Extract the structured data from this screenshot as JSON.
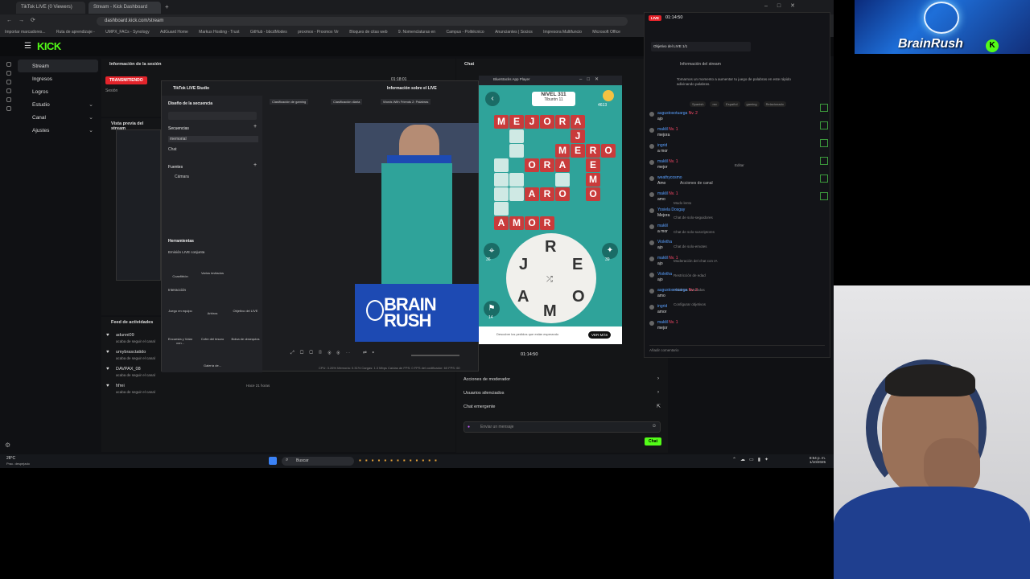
{
  "browser": {
    "tabs": [
      "TikTok LIVE (0 Viewers)",
      "Stream - Kick Dashboard"
    ],
    "url": "dashboard.kick.com/stream",
    "bookmarks": [
      "Importar marcadores...",
      "Ruta de aprendizaje -",
      "UMPX_FACs - Synology",
      "AdGuard Home",
      "Markus Hosting - Trust",
      "GitHub - bbcdModes",
      "proxmox - Proxmox Vir",
      "Bloques de citas web",
      "9. Nomenclaturas en",
      "Campus - Politécnico",
      "Anunciantes | Socios",
      "Impresora Multifuncio",
      "Microsoft Office"
    ]
  },
  "kick": {
    "logo": "KICK",
    "sidebar": [
      {
        "label": "Stream",
        "active": true
      },
      {
        "label": "Ingresos",
        "active": false
      },
      {
        "label": "Logros",
        "active": false
      },
      {
        "label": "Estudio",
        "active": false,
        "chevron": "⌄"
      },
      {
        "label": "Canal",
        "active": false,
        "chevron": "⌄"
      },
      {
        "label": "Ajustes",
        "active": false,
        "chevron": "⌄"
      }
    ],
    "session_title": "Información de la sesión",
    "live_badge": "TRANSMITIENDO",
    "session_label": "Sesión",
    "uptime": "01:18:01",
    "preview_title": "Vista previa del stream",
    "activity_title": "Feed de actividades",
    "activity": [
      {
        "user": "adunni09",
        "text": "acaba de seguir el canal"
      },
      {
        "user": "umybrasctatido",
        "text": "acaba de seguir el canal"
      },
      {
        "user": "DAVPAX_08",
        "text": "acaba de seguir el canal"
      },
      {
        "user": "hfrei",
        "text": "acaba de seguir el canal",
        "time": "Hace 21 horas"
      }
    ],
    "chat_title": "Chat",
    "mod_items": [
      "Acciones de moderador",
      "Usuarios silenciados",
      "Chat emergente"
    ],
    "chat_placeholder": "Enviar un mensaje",
    "chat_button": "Chat"
  },
  "tiktok_studio": {
    "title": "TikTok LIVE Studio",
    "live_info": "Información sobre el LIVE",
    "scene_design": "Diseño de la secuencia",
    "sequences": "Secuencias",
    "scenes": [
      "memorial",
      "Chat"
    ],
    "sources": "Fuentes",
    "source_items": [
      "Cámara"
    ],
    "tools": "Herramientas",
    "tools_sub": "Emisión LIVE conjunta",
    "tool_items": [
      "Coanfitrión",
      "Varios invitados"
    ],
    "interaction": "Interacción",
    "interaction_items": [
      "Juego en equipo",
      "Arbiros",
      "Objetivo del LIVE",
      "Encuesta y Votar con...",
      "Cofre del tesoro",
      "Bolsa de obsequios",
      "Galería de..."
    ],
    "rank_tabs": [
      "Clasificación de gaming",
      "Clasificación diaria",
      "Words With Friends 2: Palabras"
    ],
    "timer": "01:14:50",
    "stats": "CPU: 3.26%   Memoria: 0.31%   Cargas: 1.3 Mbps   Caídas de FPS: 0   FPS del codificador: 60   FPS: 60",
    "brain_rush_banner": "BRAIN RUSH"
  },
  "game": {
    "window_title": "BlueStacks App Player",
    "level": "NIVEL 311",
    "sublevel": "Tiburón 11",
    "coins": "4613",
    "wheel_letters": [
      "R",
      "J",
      "E",
      "A",
      "O",
      "M"
    ],
    "hint_count_left": "36",
    "hint_count_right": "39",
    "hint_count_bottom": "14",
    "ad_text": "Descubre los pedidos que están esperando",
    "ad_button": "VER MÁS"
  },
  "tiktok_chat": {
    "timer": "01:14:50",
    "goal_label": "Objetivo del LIVE 1/1",
    "stream_info": "Información del stream",
    "description": "Tomarnos un momento a aumentar tu juego de palabras en este rápido adivinando palabras.",
    "tags": [
      "Spanish",
      "rec",
      "Español",
      "gaming",
      "Relacionado"
    ],
    "edit": "Editar",
    "channel_actions": "Acciones de canal",
    "actions": [
      "Modo lento",
      "Chat de solo-seguidores",
      "Chat de solo-suscriptores",
      "Chat de solo-emotes",
      "Moderación del chat con IA",
      "Restricción de edad",
      "Palabras baneadas",
      "Configurar objetivos"
    ],
    "messages": [
      {
        "user": "augustosotuarga",
        "badge": "Nv. 2",
        "text": "ajo"
      },
      {
        "user": "maklil",
        "badge": "Nv. 1",
        "text": "mejora"
      },
      {
        "user": "ingrid",
        "badge": "",
        "text": "a mor"
      },
      {
        "user": "maklil",
        "badge": "Nv. 1",
        "text": "mejor"
      },
      {
        "user": "weathycosmo",
        "badge": "",
        "text": "Amo"
      },
      {
        "user": "maklil",
        "badge": "Nv. 1",
        "text": "amo"
      },
      {
        "user": "Yosiela Dosgay",
        "badge": "",
        "text": "Mejora"
      },
      {
        "user": "maklil",
        "badge": "",
        "text": "a mor"
      },
      {
        "user": "Violetha",
        "badge": "",
        "text": "ajo"
      },
      {
        "user": "maklil",
        "badge": "Nv. 1",
        "text": "ajo"
      },
      {
        "user": "Violetha",
        "badge": "",
        "text": "ajo"
      },
      {
        "user": "augustosotuarga",
        "badge": "Nv. 2",
        "text": "amo"
      },
      {
        "user": "ingrid",
        "badge": "",
        "text": "amor"
      },
      {
        "user": "maklil",
        "badge": "Nv. 1",
        "text": "mejor"
      }
    ],
    "comment_placeholder": "Añadir comentario"
  },
  "overlay": {
    "brand": "BrainRush",
    "brand_badge": "K"
  },
  "taskbar": {
    "weather": "28°C",
    "weather_sub": "Prac. despejado",
    "search": "Buscar",
    "time": "8:54 p. m.",
    "date": "1/10/2025"
  }
}
